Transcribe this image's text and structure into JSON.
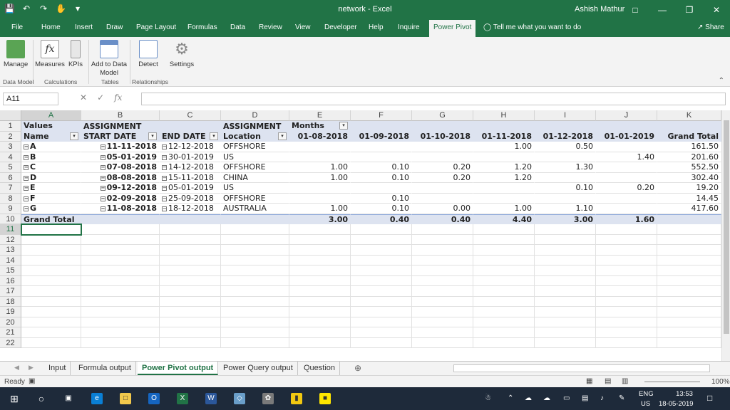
{
  "window": {
    "title": "network  -  Excel",
    "user": "Ashish Mathur"
  },
  "ribbon_tabs": [
    "File",
    "Home",
    "Insert",
    "Draw",
    "Page Layout",
    "Formulas",
    "Data",
    "Review",
    "View",
    "Developer",
    "Help",
    "Inquire",
    "Power Pivot"
  ],
  "tell_me": "Tell me what you want to do",
  "share": "Share",
  "ribbon": {
    "buttons": [
      {
        "label": "Manage",
        "color": "#5aa454"
      },
      {
        "label": "Measures",
        "color": "#ffffff"
      },
      {
        "label": "KPIs",
        "color": "#e7e7e7"
      },
      {
        "label": "Add to Data Model",
        "color": "#ffffff"
      },
      {
        "label": "Detect",
        "color": "#ffffff"
      },
      {
        "label": "Settings",
        "color": "#888888"
      }
    ],
    "groups": [
      "Data Model",
      "Calculations",
      "Tables",
      "Relationships"
    ]
  },
  "name_box": "A11",
  "column_letters": [
    "A",
    "B",
    "C",
    "D",
    "E",
    "F",
    "G",
    "H",
    "I",
    "J",
    "K"
  ],
  "row_numbers": [
    "1",
    "2",
    "3",
    "4",
    "5",
    "6",
    "7",
    "8",
    "9",
    "10",
    "11",
    "12",
    "13",
    "14",
    "15",
    "16",
    "17",
    "18",
    "19",
    "20",
    "21",
    "22"
  ],
  "pivot": {
    "row1": {
      "values_label": "Values",
      "months_label": "Months"
    },
    "row2": {
      "assignment_b": "ASSIGNMENT",
      "start_date": "START DATE",
      "end_date": "END DATE",
      "assignment_d": "ASSIGNMENT",
      "location": "Location",
      "name": "Name",
      "months": [
        "01-08-2018",
        "01-09-2018",
        "01-10-2018",
        "01-11-2018",
        "01-12-2018",
        "01-01-2019"
      ],
      "grand_total": "Grand Total"
    },
    "rows": [
      {
        "name": "A",
        "start": "11-11-2018",
        "end": "12-12-2018",
        "location": "OFFSHORE",
        "vals": [
          "",
          "",
          "",
          "1.00",
          "0.50",
          ""
        ],
        "total": "161.50"
      },
      {
        "name": "B",
        "start": "05-01-2019",
        "end": "30-01-2019",
        "location": "US",
        "vals": [
          "",
          "",
          "",
          "",
          "",
          "1.40"
        ],
        "total": "201.60"
      },
      {
        "name": "C",
        "start": "07-08-2018",
        "end": "14-12-2018",
        "location": "OFFSHORE",
        "vals": [
          "1.00",
          "0.10",
          "0.20",
          "1.20",
          "1.30",
          ""
        ],
        "total": "552.50"
      },
      {
        "name": "D",
        "start": "08-08-2018",
        "end": "15-11-2018",
        "location": "CHINA",
        "vals": [
          "1.00",
          "0.10",
          "0.20",
          "1.20",
          "",
          ""
        ],
        "total": "302.40"
      },
      {
        "name": "E",
        "start": "09-12-2018",
        "end": "05-01-2019",
        "location": "US",
        "vals": [
          "",
          "",
          "",
          "",
          "0.10",
          "0.20"
        ],
        "total": "19.20"
      },
      {
        "name": "F",
        "start": "02-09-2018",
        "end": "25-09-2018",
        "location": "OFFSHORE",
        "vals": [
          "",
          "0.10",
          "",
          "",
          "",
          ""
        ],
        "total": "14.45"
      },
      {
        "name": "G",
        "start": "11-08-2018",
        "end": "18-12-2018",
        "location": "AUSTRALIA",
        "vals": [
          "1.00",
          "0.10",
          "0.00",
          "1.00",
          "1.10",
          ""
        ],
        "total": "417.60"
      }
    ],
    "grand_total_row": {
      "label": "Grand Total",
      "vals": [
        "3.00",
        "0.40",
        "0.40",
        "4.40",
        "3.00",
        "1.60"
      ],
      "total": ""
    }
  },
  "sheets": [
    "Input",
    "Formula output",
    "Power Pivot output",
    "Power Query output",
    "Question"
  ],
  "active_sheet": "Power Pivot output",
  "status": {
    "ready": "Ready",
    "zoom": "100%"
  },
  "taskbar": {
    "lang": "ENG",
    "region": "US",
    "time": "13:53",
    "date": "18-05-2019"
  }
}
